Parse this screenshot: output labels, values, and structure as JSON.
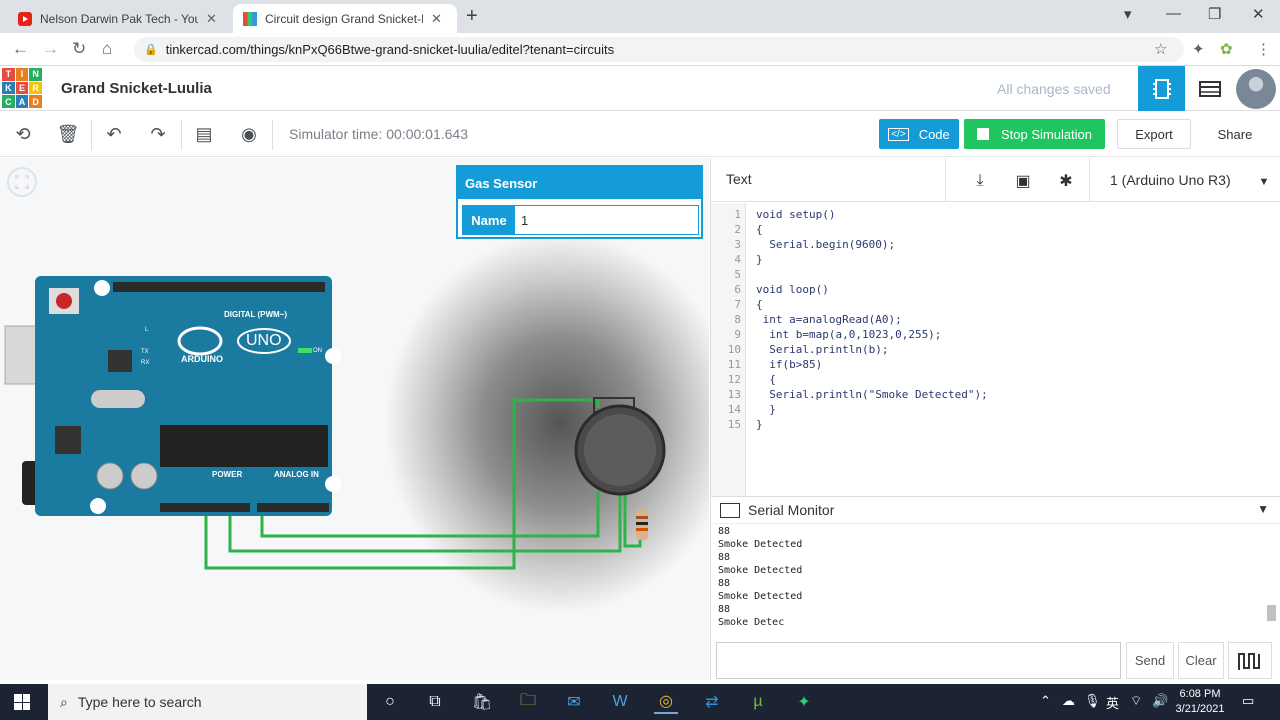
{
  "browser": {
    "tabs": [
      {
        "title": "Nelson Darwin Pak Tech - YouTube",
        "icon": "youtube-icon"
      },
      {
        "title": "Circuit design Grand Snicket-Luulia",
        "icon": "tinkercad-icon"
      }
    ],
    "url": "tinkercad.com/things/knPxQ66Btwe-grand-snicket-luulia/editel?tenant=circuits"
  },
  "header": {
    "logo_letters": [
      "T",
      "I",
      "N",
      "K",
      "E",
      "R",
      "C",
      "A",
      "D"
    ],
    "project_name": "Grand Snicket-Luulia",
    "save_status": "All changes saved"
  },
  "toolbar": {
    "sim_time": "Simulator time: 00:00:01.643",
    "code_label": "Code",
    "stop_label": "Stop Simulation",
    "export_label": "Export",
    "share_label": "Share"
  },
  "inspector": {
    "title": "Gas Sensor",
    "name_label": "Name",
    "name_value": "1"
  },
  "board": {
    "brand": "ARDUINO",
    "model": "UNO",
    "digital_label": "DIGITAL (PWM~)",
    "power_label": "POWER",
    "analog_label": "ANALOG IN",
    "on_label": "ON",
    "tx_label": "TX",
    "rx_label": "RX",
    "l_label": "L"
  },
  "code_editor": {
    "mode": "Text",
    "board_select": "1 (Arduino Uno R3)",
    "lines": [
      "void setup()",
      "{",
      "  Serial.begin(9600);",
      "}",
      "",
      "void loop()",
      "{",
      " int a=analogRead(A0);",
      "  int b=map(a,0,1023,0,255);",
      "  Serial.println(b);",
      "  if(b>85)",
      "  {",
      "  Serial.println(\"Smoke Detected\");",
      "  }",
      "}"
    ]
  },
  "serial_monitor": {
    "title": "Serial Monitor",
    "output": [
      "88",
      "Smoke Detected",
      "88",
      "Smoke Detected",
      "88",
      "Smoke Detected",
      "88",
      "Smoke Detec"
    ],
    "input_value": "",
    "send_label": "Send",
    "clear_label": "Clear"
  },
  "taskbar": {
    "search_placeholder": "Type here to search",
    "time": "6:08 PM",
    "date": "3/21/2021"
  },
  "colors": {
    "accent": "#139cd8",
    "start_stop": "#1fc660",
    "board": "#1b7aa0",
    "wire": "#2db34a"
  }
}
